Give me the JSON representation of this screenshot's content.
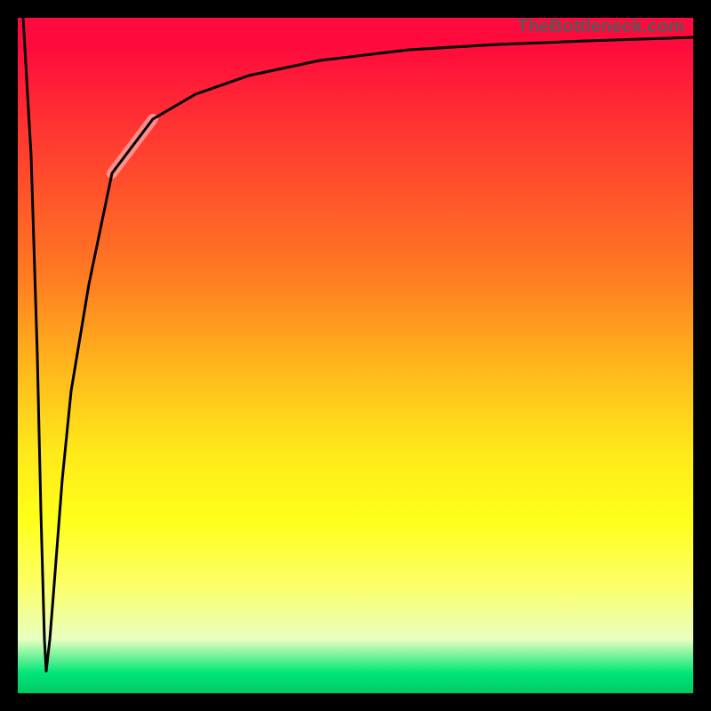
{
  "watermark": "TheBottleneck.com",
  "chart_data": {
    "type": "line",
    "title": "",
    "xlabel": "",
    "ylabel": "",
    "x": [
      0,
      2,
      4,
      6,
      8,
      10,
      12,
      14,
      16,
      18,
      20,
      25,
      30,
      35,
      40,
      50,
      60,
      70,
      80,
      90,
      100
    ],
    "values": [
      100,
      50,
      0,
      35,
      55,
      66,
      72,
      77,
      80,
      83,
      85,
      88,
      90,
      91.5,
      92.5,
      94,
      95,
      95.5,
      96,
      96.3,
      96.5
    ],
    "xlim": [
      0,
      100
    ],
    "ylim": [
      0,
      100
    ],
    "highlight_segment": {
      "x_start": 14,
      "x_end": 20
    },
    "background_gradient": [
      "#ff0a3c",
      "#ff7a22",
      "#ffff1a",
      "#00d46a"
    ],
    "annotations": []
  }
}
